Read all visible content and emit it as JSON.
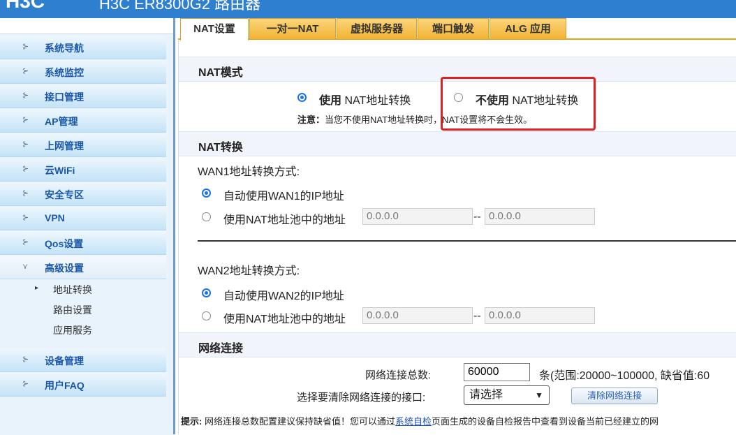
{
  "header": {
    "logo": "H3C",
    "title": "H3C ER8300G2 路由器"
  },
  "sidebar": {
    "items": [
      {
        "label": "系统导航"
      },
      {
        "label": "系统监控"
      },
      {
        "label": "接口管理"
      },
      {
        "label": "AP管理"
      },
      {
        "label": "上网管理"
      },
      {
        "label": "云WiFi"
      },
      {
        "label": "安全专区"
      },
      {
        "label": "VPN"
      },
      {
        "label": "Qos设置"
      },
      {
        "label": "高级设置"
      },
      {
        "label": "设备管理"
      },
      {
        "label": "用户FAQ"
      }
    ],
    "sub_items": [
      {
        "label": "地址转换"
      },
      {
        "label": "路由设置"
      },
      {
        "label": "应用服务"
      }
    ]
  },
  "tabs": [
    {
      "label": "NAT设置"
    },
    {
      "label": "一对一NAT"
    },
    {
      "label": "虚拟服务器"
    },
    {
      "label": "端口触发"
    },
    {
      "label": "ALG 应用"
    }
  ],
  "nat_mode": {
    "heading": "NAT模式",
    "use_bold": "使用",
    "use_rest": "NAT地址转换",
    "nouse_bold": "不使用",
    "nouse_rest": "NAT地址转换",
    "note_label": "注意：",
    "note_text": "当您不使用NAT地址转换时，NAT设置将不会生效。"
  },
  "nat_conv": {
    "heading": "NAT转换",
    "wan1_label": "WAN1地址转换方式:",
    "wan1_auto": "自动使用WAN1的IP地址",
    "wan1_pool": "使用NAT地址池中的地址",
    "wan1_start": "0.0.0.0",
    "wan1_end": "0.0.0.0",
    "wan2_label": "WAN2地址转换方式:",
    "wan2_auto": "自动使用WAN2的IP地址",
    "wan2_pool": "使用NAT地址池中的地址",
    "wan2_start": "0.0.0.0",
    "wan2_end": "0.0.0.0",
    "dash": "--"
  },
  "network": {
    "heading": "网络连接",
    "total_label": "网络连接总数:",
    "total_value": "60000",
    "range_text": "条(范围:20000~100000, 缺省值:60",
    "clear_label": "选择要清除网络连接的接口:",
    "select_value": "请选择",
    "clear_button": "清除网络连接",
    "tip_label": "提示:",
    "tip_text1": "网络连接总数配置建议保持缺省值！您可以通过",
    "tip_link": "系统自检",
    "tip_text2": "页面生成的设备自检报告中查看到设备当前已经建立的网"
  }
}
